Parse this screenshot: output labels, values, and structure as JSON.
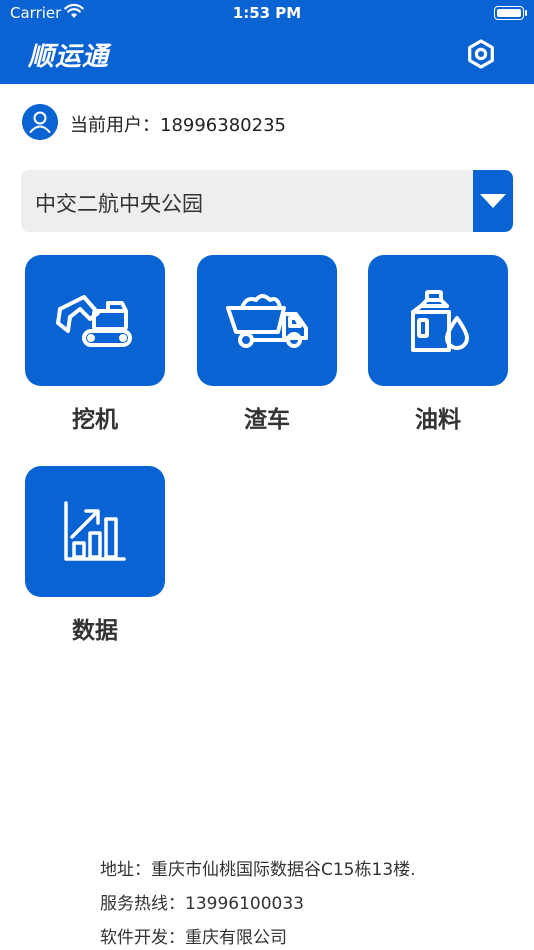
{
  "status_bar": {
    "carrier": "Carrier",
    "time": "1:53 PM"
  },
  "nav": {
    "title": "顺运通",
    "settings_icon": "gear-icon"
  },
  "user": {
    "text": "当前用户：18996380235",
    "icon": "user-icon"
  },
  "project_selector": {
    "value": "中交二航中央公园",
    "icon": "chevron-down-icon"
  },
  "tiles": [
    {
      "label": "挖机",
      "icon": "excavator-icon"
    },
    {
      "label": "渣车",
      "icon": "dump-truck-icon"
    },
    {
      "label": "油料",
      "icon": "oil-icon"
    },
    {
      "label": "数据",
      "icon": "chart-icon"
    }
  ],
  "footer": {
    "address": "地址：重庆市仙桃国际数据谷C15栋13楼.",
    "hotline": "服务热线：13996100033",
    "developer": "软件开发：重庆有限公司"
  },
  "colors": {
    "brand": "#0a63d2",
    "selector_bg": "#eeeeee"
  }
}
